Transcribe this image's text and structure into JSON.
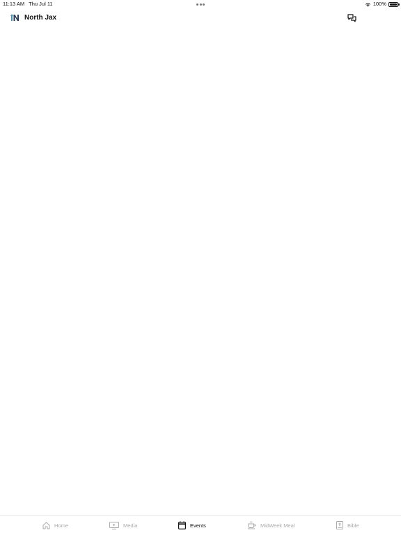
{
  "status_bar": {
    "time": "11:13 AM",
    "date": "Thu Jul 11",
    "battery_text": "100%",
    "battery_level": 1.0
  },
  "header": {
    "title": "North Jax",
    "logo_icon": "north-jax-logo",
    "chat_icon": "chat-bubbles-icon"
  },
  "tabs": [
    {
      "label": "Home",
      "icon": "home-icon",
      "active": false
    },
    {
      "label": "Media",
      "icon": "tv-play-icon",
      "active": false
    },
    {
      "label": "Events",
      "icon": "calendar-icon",
      "active": true
    },
    {
      "label": "MidWeek Meal",
      "icon": "coffee-cup-icon",
      "active": false
    },
    {
      "label": "Bible",
      "icon": "bible-icon",
      "active": false
    }
  ],
  "colors": {
    "active_tab": "#111111",
    "inactive_tab": "#aaaaaa",
    "logo_navy": "#2b3a55",
    "logo_teal": "#4a8fb0"
  }
}
